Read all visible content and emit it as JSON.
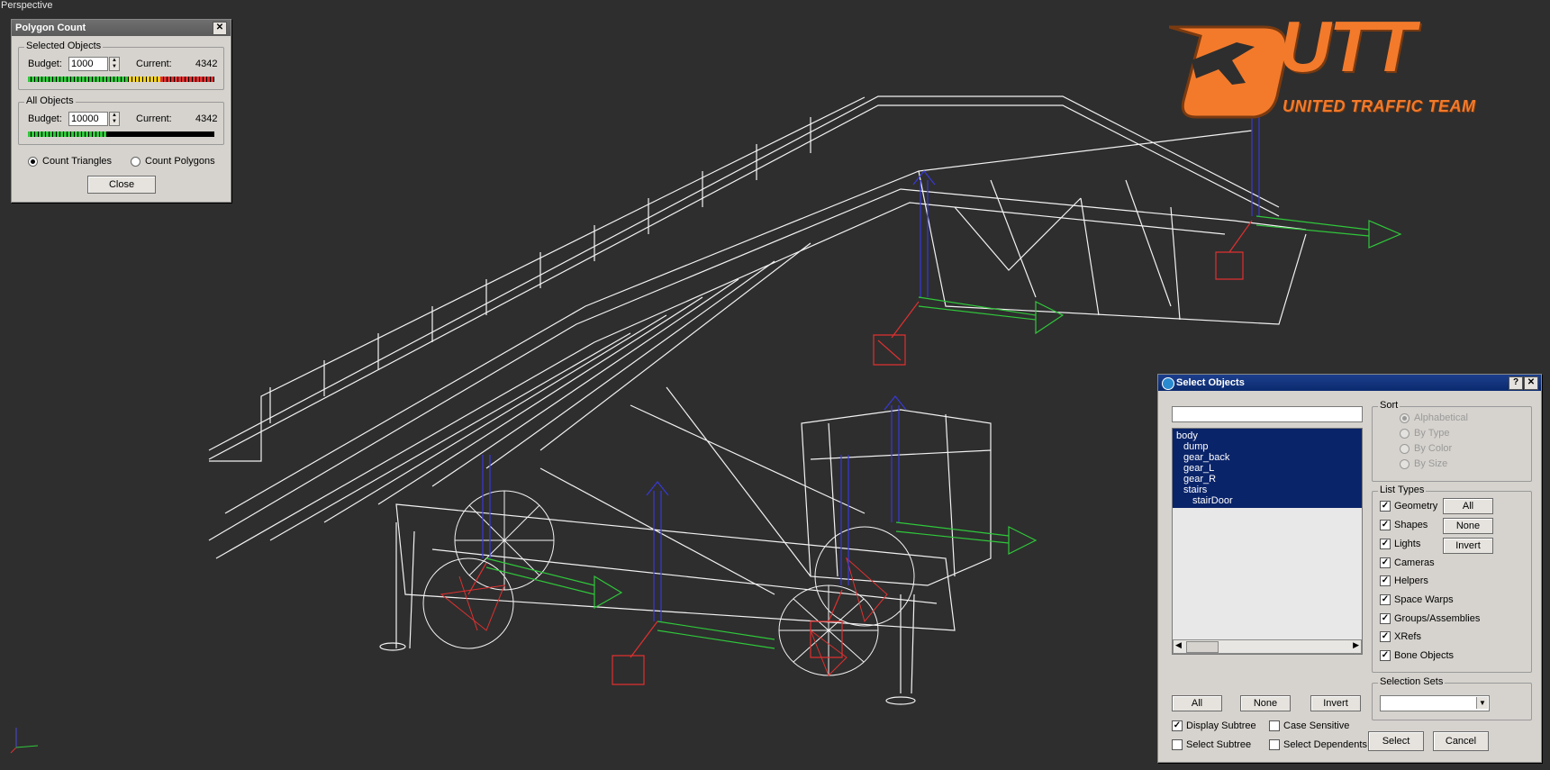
{
  "viewport": {
    "label": "Perspective"
  },
  "logo": {
    "word": "UTT",
    "tagline": "UNITED TRAFFIC TEAM",
    "color": "#f37a2b"
  },
  "polygon_count": {
    "title": "Polygon Count",
    "close_x": "✕",
    "selected_group": "Selected Objects",
    "all_group": "All Objects",
    "budget_label": "Budget:",
    "current_label": "Current:",
    "selected_budget": "1000",
    "selected_current": "4342",
    "all_budget": "10000",
    "all_current": "4342",
    "count_triangles": "Count Triangles",
    "count_polygons": "Count Polygons",
    "mode": "triangles",
    "close_button": "Close"
  },
  "select_objects": {
    "title": "Select Objects",
    "help": "?",
    "close_x": "✕",
    "search_value": "",
    "items": [
      "body",
      "dump",
      "gear_back",
      "gear_L",
      "gear_R",
      "stairs",
      "stairDoor"
    ],
    "sort": {
      "label": "Sort",
      "options": [
        "Alphabetical",
        "By Type",
        "By Color",
        "By Size"
      ],
      "selected": "Alphabetical"
    },
    "list_types": {
      "label": "List Types",
      "items": [
        "Geometry",
        "Shapes",
        "Lights",
        "Cameras",
        "Helpers",
        "Space Warps",
        "Groups/Assemblies",
        "XRefs",
        "Bone Objects"
      ],
      "all": "All",
      "none": "None",
      "invert": "Invert"
    },
    "selection_sets": {
      "label": "Selection Sets",
      "value": ""
    },
    "bottom": {
      "all": "All",
      "none": "None",
      "invert": "Invert",
      "display_subtree": "Display Subtree",
      "case_sensitive": "Case Sensitive",
      "select_subtree": "Select Subtree",
      "select_dependents": "Select Dependents",
      "select": "Select",
      "cancel": "Cancel"
    }
  }
}
